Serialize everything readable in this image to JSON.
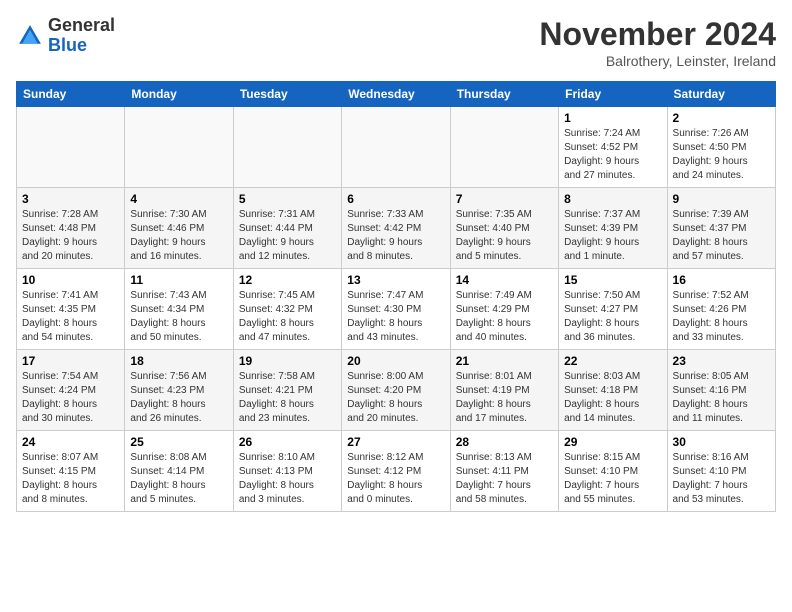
{
  "header": {
    "logo_line1": "General",
    "logo_line2": "Blue",
    "month": "November 2024",
    "location": "Balrothery, Leinster, Ireland"
  },
  "weekdays": [
    "Sunday",
    "Monday",
    "Tuesday",
    "Wednesday",
    "Thursday",
    "Friday",
    "Saturday"
  ],
  "weeks": [
    [
      {
        "day": "",
        "info": ""
      },
      {
        "day": "",
        "info": ""
      },
      {
        "day": "",
        "info": ""
      },
      {
        "day": "",
        "info": ""
      },
      {
        "day": "",
        "info": ""
      },
      {
        "day": "1",
        "info": "Sunrise: 7:24 AM\nSunset: 4:52 PM\nDaylight: 9 hours\nand 27 minutes."
      },
      {
        "day": "2",
        "info": "Sunrise: 7:26 AM\nSunset: 4:50 PM\nDaylight: 9 hours\nand 24 minutes."
      }
    ],
    [
      {
        "day": "3",
        "info": "Sunrise: 7:28 AM\nSunset: 4:48 PM\nDaylight: 9 hours\nand 20 minutes."
      },
      {
        "day": "4",
        "info": "Sunrise: 7:30 AM\nSunset: 4:46 PM\nDaylight: 9 hours\nand 16 minutes."
      },
      {
        "day": "5",
        "info": "Sunrise: 7:31 AM\nSunset: 4:44 PM\nDaylight: 9 hours\nand 12 minutes."
      },
      {
        "day": "6",
        "info": "Sunrise: 7:33 AM\nSunset: 4:42 PM\nDaylight: 9 hours\nand 8 minutes."
      },
      {
        "day": "7",
        "info": "Sunrise: 7:35 AM\nSunset: 4:40 PM\nDaylight: 9 hours\nand 5 minutes."
      },
      {
        "day": "8",
        "info": "Sunrise: 7:37 AM\nSunset: 4:39 PM\nDaylight: 9 hours\nand 1 minute."
      },
      {
        "day": "9",
        "info": "Sunrise: 7:39 AM\nSunset: 4:37 PM\nDaylight: 8 hours\nand 57 minutes."
      }
    ],
    [
      {
        "day": "10",
        "info": "Sunrise: 7:41 AM\nSunset: 4:35 PM\nDaylight: 8 hours\nand 54 minutes."
      },
      {
        "day": "11",
        "info": "Sunrise: 7:43 AM\nSunset: 4:34 PM\nDaylight: 8 hours\nand 50 minutes."
      },
      {
        "day": "12",
        "info": "Sunrise: 7:45 AM\nSunset: 4:32 PM\nDaylight: 8 hours\nand 47 minutes."
      },
      {
        "day": "13",
        "info": "Sunrise: 7:47 AM\nSunset: 4:30 PM\nDaylight: 8 hours\nand 43 minutes."
      },
      {
        "day": "14",
        "info": "Sunrise: 7:49 AM\nSunset: 4:29 PM\nDaylight: 8 hours\nand 40 minutes."
      },
      {
        "day": "15",
        "info": "Sunrise: 7:50 AM\nSunset: 4:27 PM\nDaylight: 8 hours\nand 36 minutes."
      },
      {
        "day": "16",
        "info": "Sunrise: 7:52 AM\nSunset: 4:26 PM\nDaylight: 8 hours\nand 33 minutes."
      }
    ],
    [
      {
        "day": "17",
        "info": "Sunrise: 7:54 AM\nSunset: 4:24 PM\nDaylight: 8 hours\nand 30 minutes."
      },
      {
        "day": "18",
        "info": "Sunrise: 7:56 AM\nSunset: 4:23 PM\nDaylight: 8 hours\nand 26 minutes."
      },
      {
        "day": "19",
        "info": "Sunrise: 7:58 AM\nSunset: 4:21 PM\nDaylight: 8 hours\nand 23 minutes."
      },
      {
        "day": "20",
        "info": "Sunrise: 8:00 AM\nSunset: 4:20 PM\nDaylight: 8 hours\nand 20 minutes."
      },
      {
        "day": "21",
        "info": "Sunrise: 8:01 AM\nSunset: 4:19 PM\nDaylight: 8 hours\nand 17 minutes."
      },
      {
        "day": "22",
        "info": "Sunrise: 8:03 AM\nSunset: 4:18 PM\nDaylight: 8 hours\nand 14 minutes."
      },
      {
        "day": "23",
        "info": "Sunrise: 8:05 AM\nSunset: 4:16 PM\nDaylight: 8 hours\nand 11 minutes."
      }
    ],
    [
      {
        "day": "24",
        "info": "Sunrise: 8:07 AM\nSunset: 4:15 PM\nDaylight: 8 hours\nand 8 minutes."
      },
      {
        "day": "25",
        "info": "Sunrise: 8:08 AM\nSunset: 4:14 PM\nDaylight: 8 hours\nand 5 minutes."
      },
      {
        "day": "26",
        "info": "Sunrise: 8:10 AM\nSunset: 4:13 PM\nDaylight: 8 hours\nand 3 minutes."
      },
      {
        "day": "27",
        "info": "Sunrise: 8:12 AM\nSunset: 4:12 PM\nDaylight: 8 hours\nand 0 minutes."
      },
      {
        "day": "28",
        "info": "Sunrise: 8:13 AM\nSunset: 4:11 PM\nDaylight: 7 hours\nand 58 minutes."
      },
      {
        "day": "29",
        "info": "Sunrise: 8:15 AM\nSunset: 4:10 PM\nDaylight: 7 hours\nand 55 minutes."
      },
      {
        "day": "30",
        "info": "Sunrise: 8:16 AM\nSunset: 4:10 PM\nDaylight: 7 hours\nand 53 minutes."
      }
    ]
  ]
}
